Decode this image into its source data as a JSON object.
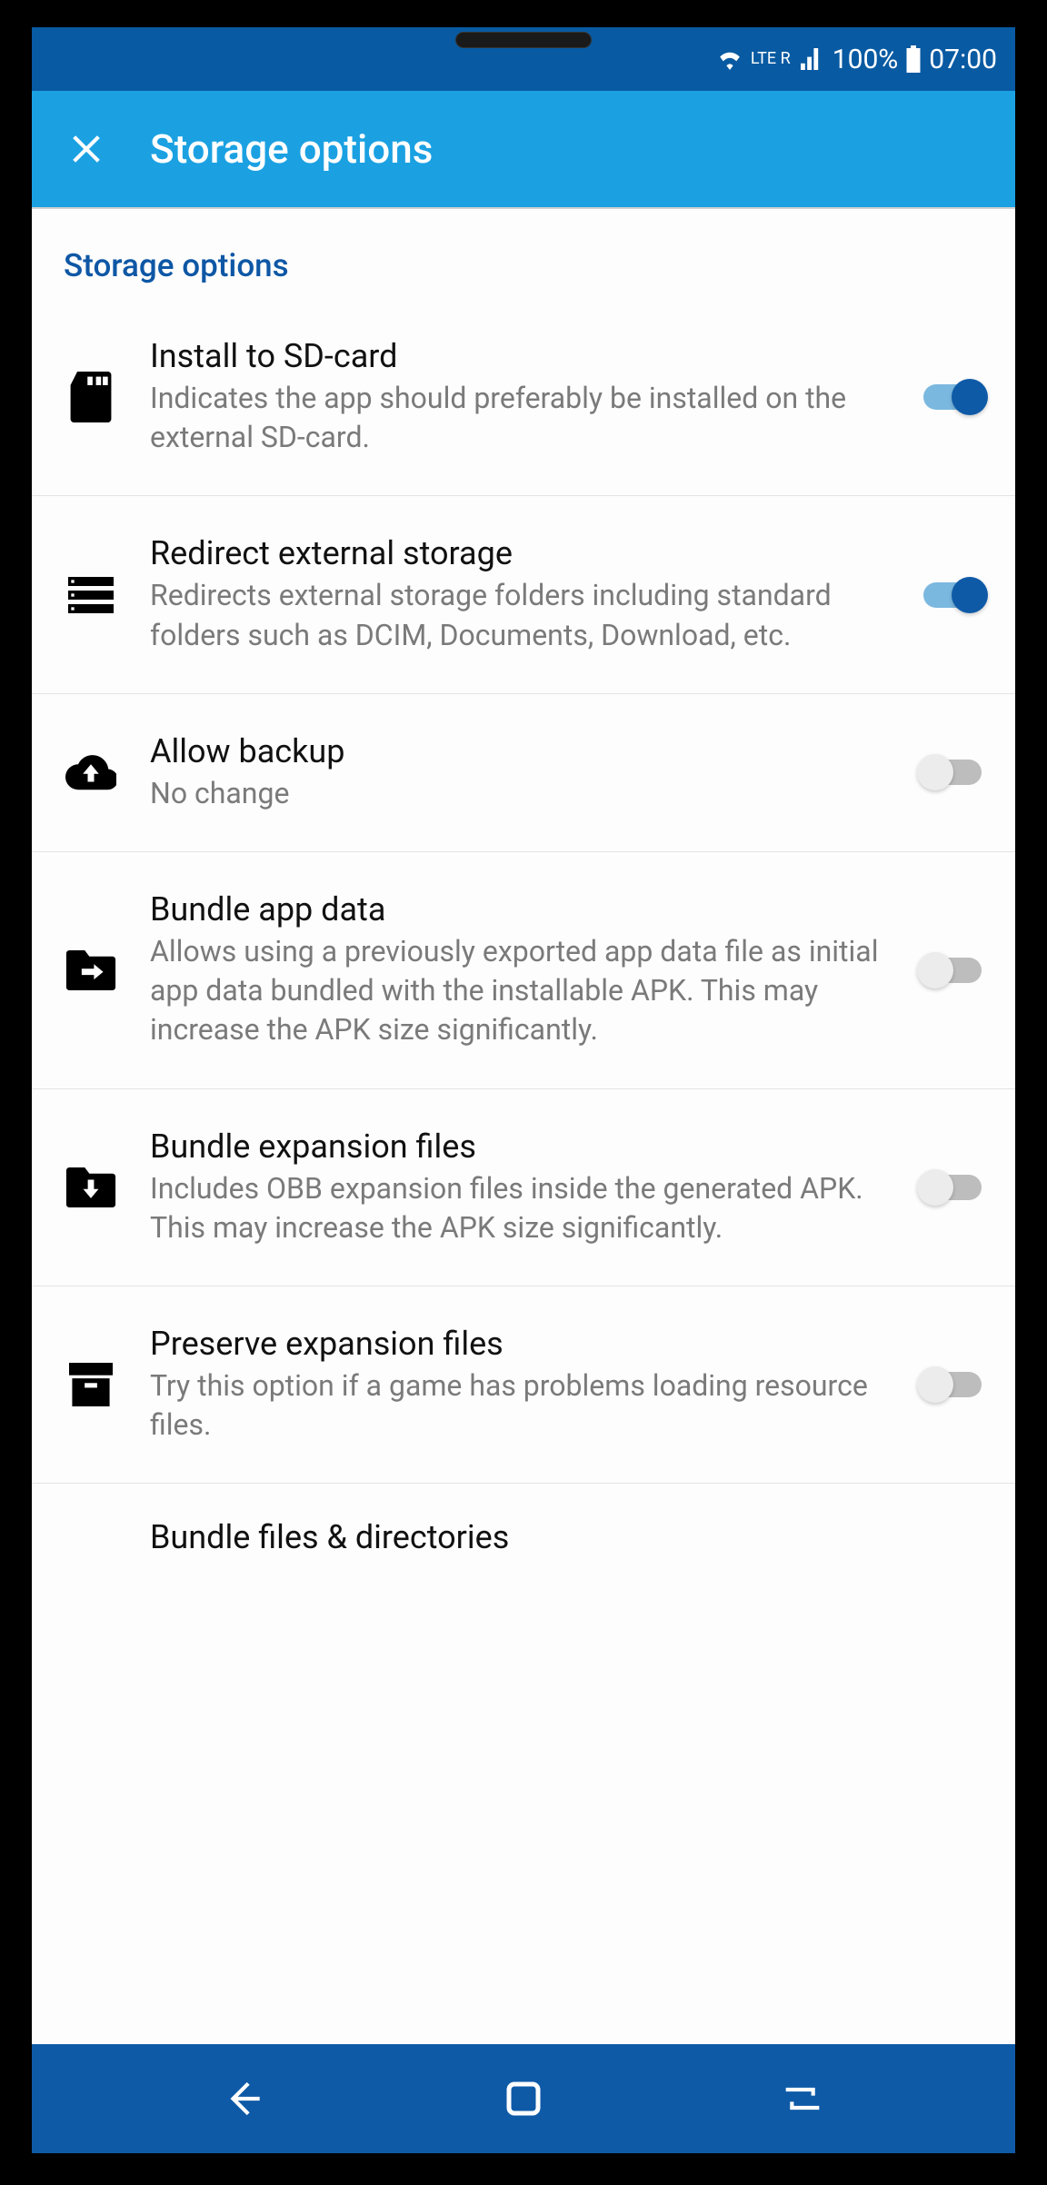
{
  "status": {
    "lte": "LTE R",
    "battery_pct": "100%",
    "time": "07:00"
  },
  "appbar": {
    "title": "Storage options"
  },
  "section": {
    "header": "Storage options"
  },
  "items": [
    {
      "icon": "sd-card-icon",
      "title": "Install to SD-card",
      "sub": "Indicates the app should preferably be installed on the external SD-card.",
      "toggle": true
    },
    {
      "icon": "storage-icon",
      "title": "Redirect external storage",
      "sub": "Redirects external storage folders including standard folders such as DCIM, Documents, Download, etc.",
      "toggle": true
    },
    {
      "icon": "cloud-upload-icon",
      "title": "Allow backup",
      "sub": "No change",
      "toggle": false
    },
    {
      "icon": "folder-arrow-icon",
      "title": "Bundle app data",
      "sub": "Allows using a previously exported app data file as initial app data bundled with the installable APK. This may increase the APK size significantly.",
      "toggle": false
    },
    {
      "icon": "folder-download-icon",
      "title": "Bundle expansion files",
      "sub": "Includes OBB expansion files inside the generated APK. This may increase the APK size significantly.",
      "toggle": false
    },
    {
      "icon": "archive-icon",
      "title": "Preserve expansion files",
      "sub": "Try this option if a game has problems loading resource files.",
      "toggle": false
    },
    {
      "icon": "",
      "title": "Bundle files & directories",
      "sub": "",
      "toggle": null
    }
  ]
}
